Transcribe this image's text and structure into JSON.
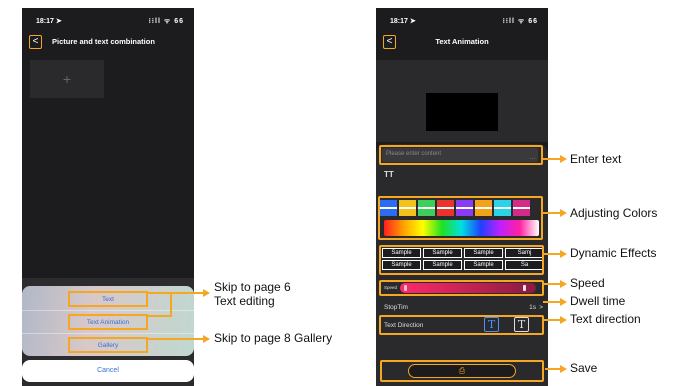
{
  "left_phone": {
    "status": {
      "time": "18:17 ➤",
      "icons": "⁝⁝ll ᯤ 66"
    },
    "nav": {
      "back": "<",
      "title": "Picture and text combination"
    },
    "add_tile": "+",
    "sheet": {
      "item_text": "Text",
      "item_animation": "Text Animation",
      "item_gallery": "Gallery",
      "cancel": "Cancel"
    }
  },
  "right_phone": {
    "status": {
      "time": "18:17 ➤",
      "icons": "⁝⁝ll ᯤ 66"
    },
    "nav": {
      "back": "<",
      "title": "Text Animation"
    },
    "text_input": {
      "placeholder": "Please enter content",
      "corner": "..."
    },
    "fontsize_icon": "TT",
    "swatch_colors": [
      "#2a6df4",
      "#f4c21a",
      "#3ccf5a",
      "#e8342c",
      "#8a3cf4",
      "#f4a21a",
      "#2ad4e8",
      "#d42a8a"
    ],
    "effects": [
      "Sample",
      "Sample",
      "Sample",
      "Samj",
      "Sample",
      "Sample",
      "Sample",
      "Sa"
    ],
    "speed": {
      "label": "Speed"
    },
    "stoptime": {
      "label": "StopTim",
      "value": "1s",
      "chevron": ">"
    },
    "direction": {
      "label": "Text Direction",
      "horizontal": "T",
      "vertical": "T"
    },
    "save_icon": "⎙"
  },
  "callouts": {
    "skip_page6": "Skip to page 6",
    "text_editing": "Text editing",
    "skip_page8": "Skip to page 8 Gallery",
    "enter_text": "Enter text",
    "adjusting_colors": "Adjusting Colors",
    "dynamic_effects": "Dynamic Effects",
    "speed": "Speed",
    "dwell_time": "Dwell time",
    "text_direction": "Text direction",
    "save": "Save"
  },
  "colors": {
    "accent": "#f5a623",
    "link_blue": "#3a6fd8"
  }
}
